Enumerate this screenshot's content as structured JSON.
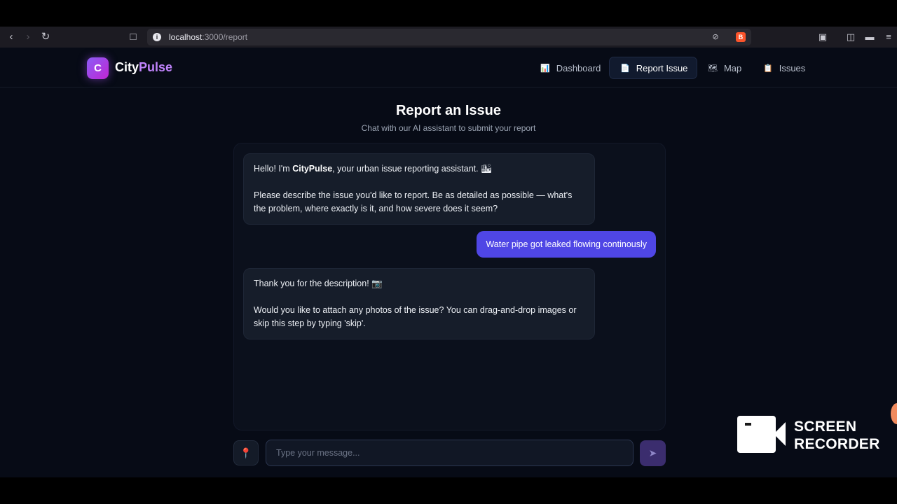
{
  "browser": {
    "url_host": "localhost",
    "url_path": ":3000/report",
    "info_glyph": "i",
    "brave_glyph": "B"
  },
  "app": {
    "brand_logo_letter": "C",
    "brand_city": "City",
    "brand_pulse": "Pulse",
    "nav": [
      {
        "label": "Dashboard",
        "icon": "📊",
        "active": false
      },
      {
        "label": "Report Issue",
        "icon": "📄",
        "active": true
      },
      {
        "label": "Map",
        "icon": "🗺",
        "active": false
      },
      {
        "label": "Issues",
        "icon": "📋",
        "active": false
      }
    ]
  },
  "page": {
    "title": "Report an Issue",
    "subtitle": "Chat with our AI assistant to submit your report"
  },
  "chat": {
    "bot_message_1": {
      "prefix": "Hello! I'm ",
      "bold": "CityPulse",
      "suffix": ", your urban issue reporting assistant. 🏙",
      "paragraph_2": "Please describe the issue you'd like to report. Be as detailed as possible — what's the problem, where exactly is it, and how severe does it seem?"
    },
    "user_message_1": "Water pipe got leaked flowing continously",
    "bot_message_2": {
      "paragraph_1": "Thank you for the description! 📷",
      "paragraph_2": "Would you like to attach any photos of the issue? You can drag-and-drop images or skip this step by typing 'skip'."
    }
  },
  "composer": {
    "placeholder": "Type your message...",
    "value": "",
    "pin_glyph": "📍",
    "send_glyph": "➤"
  },
  "watermark": {
    "line1": "SCREEN",
    "line2": "RECORDER"
  },
  "colors": {
    "accent": "#4f46e5",
    "brand_gradient_start": "#8b5cf6",
    "brand_gradient_end": "#c026d3",
    "pulse_text": "#c084fc",
    "page_background": "#070b16"
  }
}
